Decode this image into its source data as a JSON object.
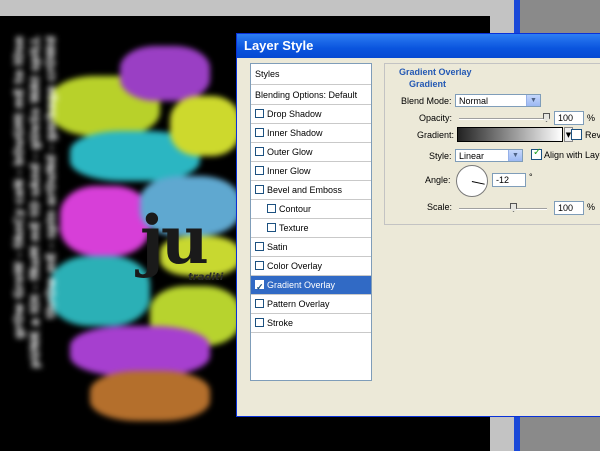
{
  "dialog": {
    "title": "Layer Style"
  },
  "styles_list": [
    {
      "label": "Styles",
      "checkbox": false,
      "checked": false,
      "selected": false,
      "indent": false
    },
    {
      "label": "Blending Options: Default",
      "checkbox": false,
      "checked": false,
      "selected": false,
      "indent": false
    },
    {
      "label": "Drop Shadow",
      "checkbox": true,
      "checked": false,
      "selected": false,
      "indent": false
    },
    {
      "label": "Inner Shadow",
      "checkbox": true,
      "checked": false,
      "selected": false,
      "indent": false
    },
    {
      "label": "Outer Glow",
      "checkbox": true,
      "checked": false,
      "selected": false,
      "indent": false
    },
    {
      "label": "Inner Glow",
      "checkbox": true,
      "checked": false,
      "selected": false,
      "indent": false
    },
    {
      "label": "Bevel and Emboss",
      "checkbox": true,
      "checked": false,
      "selected": false,
      "indent": false
    },
    {
      "label": "Contour",
      "checkbox": true,
      "checked": false,
      "selected": false,
      "indent": true
    },
    {
      "label": "Texture",
      "checkbox": true,
      "checked": false,
      "selected": false,
      "indent": true
    },
    {
      "label": "Satin",
      "checkbox": true,
      "checked": false,
      "selected": false,
      "indent": false
    },
    {
      "label": "Color Overlay",
      "checkbox": true,
      "checked": false,
      "selected": false,
      "indent": false
    },
    {
      "label": "Gradient Overlay",
      "checkbox": true,
      "checked": true,
      "selected": true,
      "indent": false
    },
    {
      "label": "Pattern Overlay",
      "checkbox": true,
      "checked": false,
      "selected": false,
      "indent": false
    },
    {
      "label": "Stroke",
      "checkbox": true,
      "checked": false,
      "selected": false,
      "indent": false
    }
  ],
  "gradient_overlay": {
    "section_title": "Gradient Overlay",
    "group_title": "Gradient",
    "blend_mode_label": "Blend Mode:",
    "blend_mode_value": "Normal",
    "opacity_label": "Opacity:",
    "opacity_value": "100",
    "opacity_unit": "%",
    "gradient_label": "Gradient:",
    "reverse_label": "Reve",
    "reverse_checked": false,
    "style_label": "Style:",
    "style_value": "Linear",
    "align_label": "Align with Laye",
    "align_checked": true,
    "angle_label": "Angle:",
    "angle_value": "-12",
    "angle_unit": "°",
    "scale_label": "Scale:",
    "scale_value": "100",
    "scale_unit": "%"
  },
  "artwork": {
    "big_text": "ju",
    "small_text": "traditi",
    "lines": [
      "thrOw mE - spIn arOuNd - garbage crOWd",
      "pUNK a lOt - fRoM mE tO sAnd - gUeSs WAt spILL",
      "grOw GroW - fAnCy caN - bOuGHt mE to lOse"
    ]
  }
}
